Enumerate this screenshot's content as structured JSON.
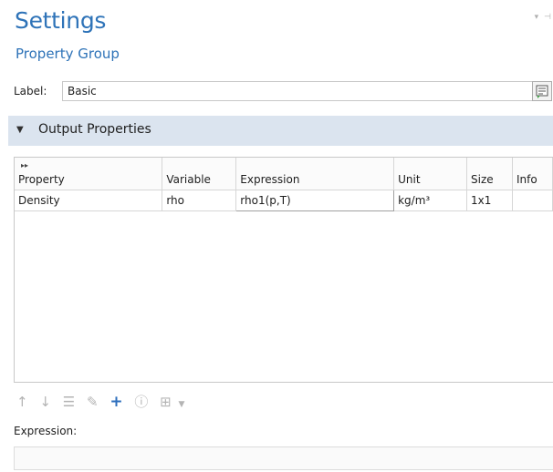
{
  "header": {
    "title": "Settings",
    "subtitle": "Property Group"
  },
  "label_row": {
    "label": "Label:",
    "value": "Basic"
  },
  "section": {
    "title": "Output Properties"
  },
  "table": {
    "columns": [
      "Property",
      "Variable",
      "Expression",
      "Unit",
      "Size",
      "Info"
    ],
    "rows": [
      {
        "property": "Density",
        "variable": "rho",
        "expression": "rho1(p,T)",
        "unit": "kg/m³",
        "size": "1x1",
        "info": ""
      }
    ]
  },
  "toolbar": {
    "icons": [
      "move-up-icon",
      "move-down-icon",
      "clear-table-icon",
      "edit-icon",
      "add-icon",
      "info-icon",
      "insert-expression-icon",
      "dropdown-icon"
    ]
  },
  "expression": {
    "label": "Expression:",
    "value": ""
  },
  "colors": {
    "accent": "#2e73b8",
    "section_bg": "#dbe4ef",
    "add_icon": "#2e6fbd"
  }
}
